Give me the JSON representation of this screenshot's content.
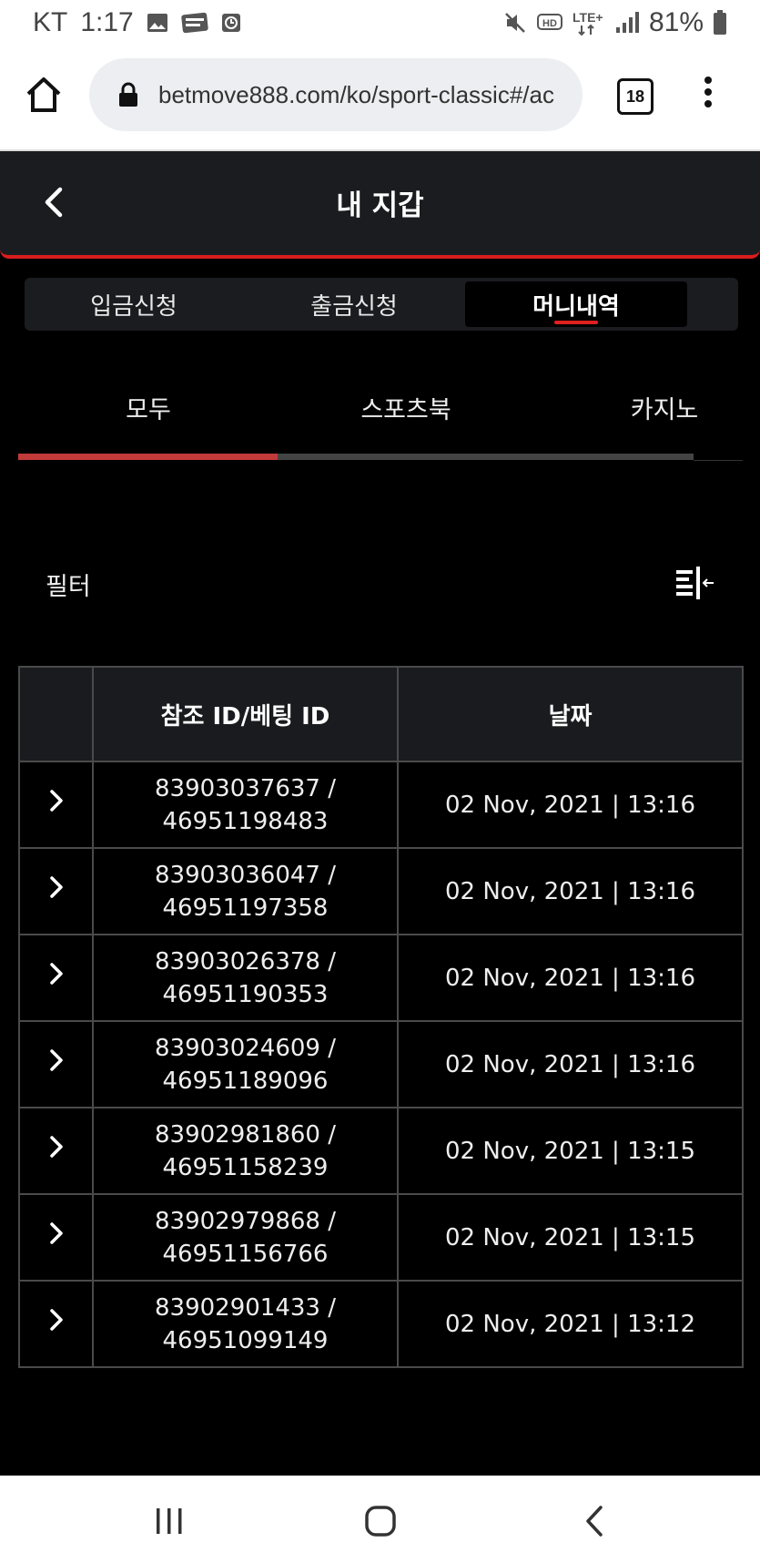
{
  "status_bar": {
    "carrier": "KT",
    "time": "1:17",
    "battery": "81%"
  },
  "browser": {
    "url": "betmove888.com/ko/sport-classic#/ac",
    "tab_count": "18"
  },
  "header": {
    "title": "내 지갑"
  },
  "segment_tabs": [
    {
      "label": "입금신청",
      "active": false
    },
    {
      "label": "출금신청",
      "active": false
    },
    {
      "label": "머니내역",
      "active": true
    }
  ],
  "category_tabs": [
    {
      "label": "모두",
      "active": true
    },
    {
      "label": "스포츠북",
      "active": false
    },
    {
      "label": "카지노",
      "active": false
    }
  ],
  "filter": {
    "label": "필터"
  },
  "table": {
    "headers": [
      "참조 ID/베팅 ID",
      "날짜"
    ],
    "rows": [
      {
        "ref_id": "83903037637 /",
        "bet_id": "46951198483",
        "date": "02 Nov, 2021 | 13:16"
      },
      {
        "ref_id": "83903036047 /",
        "bet_id": "46951197358",
        "date": "02 Nov, 2021 | 13:16"
      },
      {
        "ref_id": "83903026378 /",
        "bet_id": "46951190353",
        "date": "02 Nov, 2021 | 13:16"
      },
      {
        "ref_id": "83903024609 /",
        "bet_id": "46951189096",
        "date": "02 Nov, 2021 | 13:16"
      },
      {
        "ref_id": "83902981860 /",
        "bet_id": "46951158239",
        "date": "02 Nov, 2021 | 13:15"
      },
      {
        "ref_id": "83902979868 /",
        "bet_id": "46951156766",
        "date": "02 Nov, 2021 | 13:15"
      },
      {
        "ref_id": "83902901433 /",
        "bet_id": "46951099149",
        "date": "02 Nov, 2021 | 13:12"
      }
    ]
  },
  "colors": {
    "accent": "#d71d1d",
    "background": "#000000",
    "panel": "#1b1c20"
  }
}
